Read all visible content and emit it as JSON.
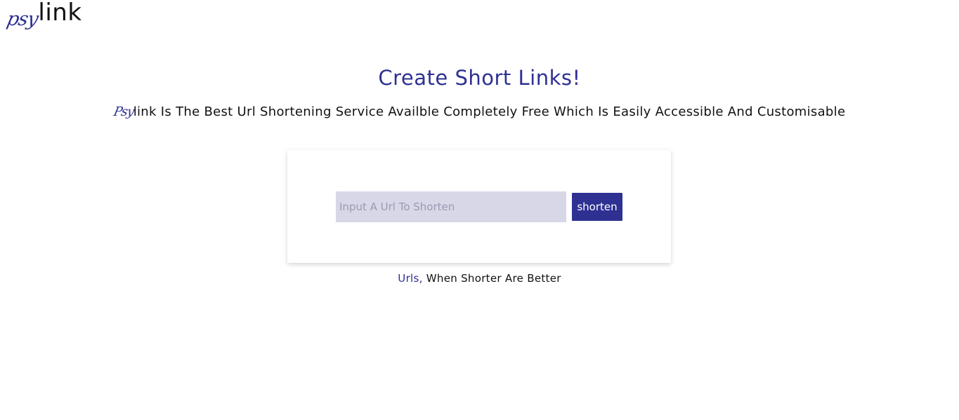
{
  "logo": {
    "psy": "psy",
    "link": "link"
  },
  "hero": {
    "title": "Create Short Links!",
    "subtitle_brand_psy": "Psy",
    "subtitle_rest": "link Is The Best Url Shortening Service Availble Completely Free Which Is Easily Accessible And Customisable"
  },
  "form": {
    "input_placeholder": "Input A Url To Shorten",
    "input_value": "",
    "button_label": "shorten"
  },
  "tagline": {
    "accent": "Urls,",
    "rest": " When Shorter Are Better"
  },
  "colors": {
    "brand": "#2e3192",
    "input_bg": "#d7d7e8",
    "text": "#111111"
  }
}
